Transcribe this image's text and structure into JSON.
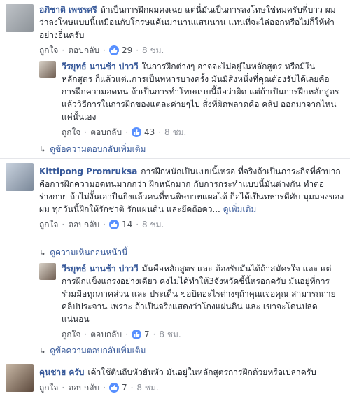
{
  "comments": [
    {
      "author": "อภิชาติ เพชรศรี",
      "text": "ถ้าเป็นการฝึกผมคงเฉย แต่นี่มันเป็นการลงโทษใช่หมครับพี่บาว ผมว่าลงโทษแบบนี้เหมือนกับโกรษแค้นมานานแสนนาน แทนที่จะไล่ออกหรือไม่ก็ให้ทำอย่างอื่นครับ",
      "like_label": "ถูกใจ",
      "reply_label": "ตอบกลับ",
      "likes": "29",
      "time": "8 ชม.",
      "reply": {
        "author": "วีรยุทธ์ นานช้า บ่าววี",
        "text": "ในการฝึกต่างๆ อาจจะไม่อยู่ในหลักสูตร หรือมีในหลักสูตร ก็แล้วแต่..การเป็นทหารบางครั้ง มันมีสิ่งหนึ่งที่คุณต้องรับได้เลยคือ การฝึกความอดทน ถ้าเป็นการทำโทษแบบนี้ถือว่าผิด แต่ถ้าเป็นการฝึกหลักสูตร แล้ววิธีการในการฝึกของแต่ละค่ายๆไป สิ่งที่ผิดพลาดคือ คลิป ออกมาจากไหน แค่นั้นเอง",
        "like_label": "ถูกใจ",
        "reply_label": "ตอบกลับ",
        "likes": "43",
        "time": "8 ชม."
      },
      "more_replies": "ดูข้อความตอบกลับเพิ่มเติม"
    },
    {
      "author": "Kittipong Promruksa",
      "text": "การฝึกหนักเป็นแบบนี้เหรอ ที่จริงถ้าเป็นภาระกิจที่ลำบากคือการฝึกความอดทนมากกว่า ฝึกหนักมาก กับการกระทำแบบนี้มันต่างกัน ทำต่อร่างกาย ถ้าไม่งั้นเอาปืนยิงแล้วคนที่ทนพิษบาทแผลได้ ก็อได้เป็นทหารดีคับ มุมมองของผม ทุกวันนี้ฝึกให้รักชาติ รักแผ่นดิน และยึดถือคว...",
      "see_more": "ดูเพิ่มเติม",
      "like_label": "ถูกใจ",
      "reply_label": "ตอบกลับ",
      "likes": "14",
      "time": "8 ชม.",
      "previous_replies": "ดูความเห็นก่อนหน้านี้",
      "reply": {
        "author": "วีรยุทธ์ นานช้า บ่าววี",
        "text": "มันคือหลักสูตร และ ต้องรับมันได้ถ้าสมัครใจ และ แต่การฝึกแข็งแกร่งอย่างเดียว คงไม่ได้ทำให้3จังหวัดชี้นี้หรอกครับ มันอยู่ที่การร่วมมือทุกภาคส่วน และ ประเด็น ขอบิดอะไรต่างๆถ้าคุณเจอคุณ สามารถถ่ายคลิปประจาน เพราะ ถ้าเป็นจริงแสดงว่าโกงแผ่นดิน และ เขาจะโดนปลดแน่นอน",
        "like_label": "ถูกใจ",
        "reply_label": "ตอบกลับ",
        "likes": "7",
        "time": "8 ชม."
      },
      "more_replies": "ดูข้อความตอบกลับเพิ่มเติม"
    },
    {
      "author": "คุนชาย ครับ",
      "text": "เค้าใช้ตีนถีบหัวยันหัว มันอยู่ในหลักสูตรการฝึกด้วยหรือเปล่าครับ",
      "like_label": "ถูกใจ",
      "reply_label": "ตอบกลับ",
      "likes": "7",
      "time": "8 ชม."
    }
  ],
  "colors": {
    "link": "#365899",
    "text": "#1d2129",
    "meta": "#90949c",
    "like": "#5890ff"
  }
}
